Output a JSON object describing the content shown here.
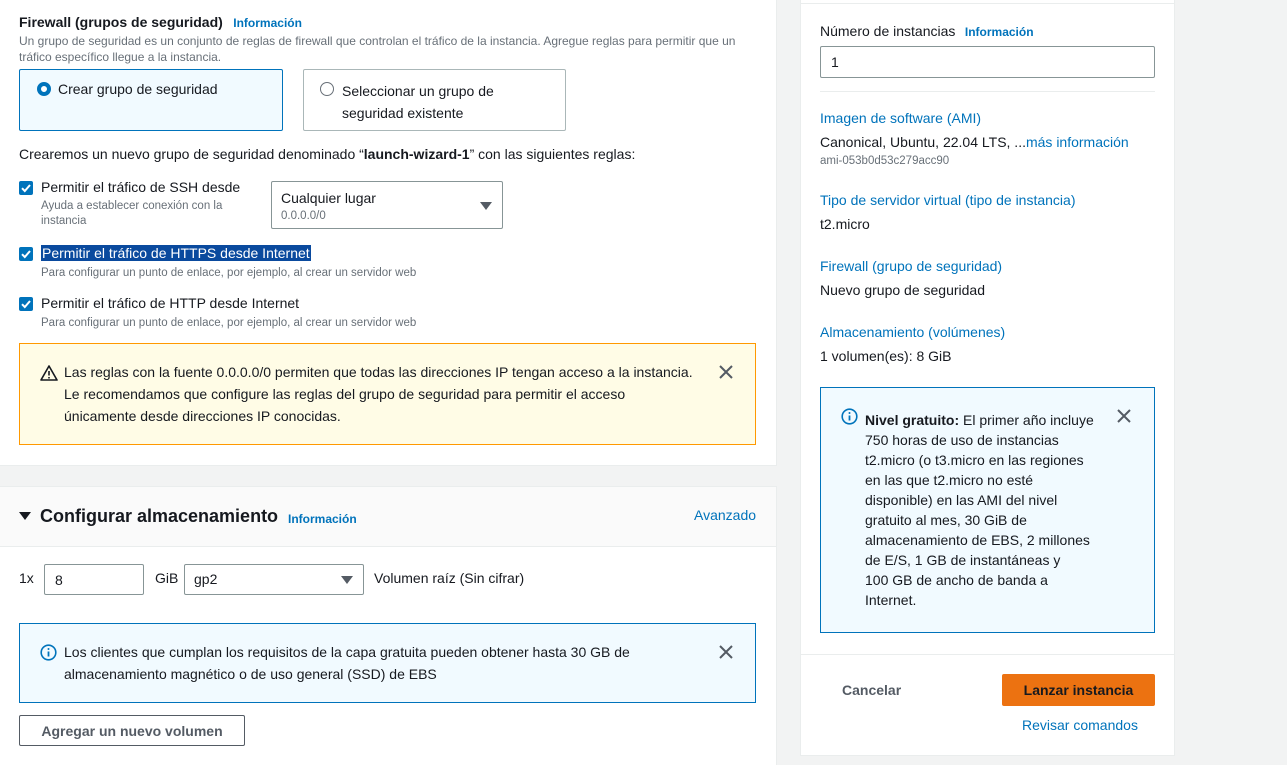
{
  "firewall": {
    "title": "Firewall (grupos de seguridad)",
    "info": "Información",
    "description_line1": "Un grupo de seguridad es un conjunto de reglas de firewall que controlan el tráfico de la instancia. Agregue reglas para permitir que un",
    "description_line2": "tráfico específico llegue a la instancia.",
    "option_create": "Crear grupo de seguridad",
    "option_select_line1": "Seleccionar un grupo de",
    "option_select_line2": "seguridad existente",
    "statement_prefix": "Crearemos un nuevo grupo de seguridad denominado “",
    "group_name": "launch-wizard-1",
    "statement_suffix": "” con las siguientes reglas:",
    "ssh_label": "Permitir el tráfico de SSH desde",
    "ssh_help_line1": "Ayuda a establecer conexión con la",
    "ssh_help_line2": "instancia",
    "ssh_source_value": "Cualquier lugar",
    "ssh_source_sub": "0.0.0.0/0",
    "https_label": "Permitir el tráfico de HTTPS desde Internet",
    "https_help": "Para configurar un punto de enlace, por ejemplo, al crear un servidor web",
    "http_label": "Permitir el tráfico de HTTP desde Internet",
    "http_help": "Para configurar un punto de enlace, por ejemplo, al crear un servidor web",
    "warning_line1": "Las reglas con la fuente 0.0.0.0/0 permiten que todas las direcciones IP tengan acceso a la instancia.",
    "warning_line2": "Le recomendamos que configure las reglas del grupo de seguridad para permitir el acceso",
    "warning_line3": "únicamente desde direcciones IP conocidas."
  },
  "storage": {
    "title": "Configurar almacenamiento",
    "info": "Información",
    "advanced": "Avanzado",
    "count_prefix": "1x",
    "size_value": "8",
    "unit": "GiB",
    "volume_type": "gp2",
    "volume_desc": "Volumen raíz  (Sin cifrar)",
    "info_line1": "Los clientes que cumplan los requisitos de la capa gratuita pueden obtener hasta 30 GB de",
    "info_line2": "almacenamiento magnético o de uso general (SSD) de EBS",
    "add_volume": "Agregar un nuevo volumen"
  },
  "summary": {
    "instances_label": "Número de instancias",
    "instances_info": "Información",
    "instances_value": "1",
    "ami_label": "Imagen de software (AMI)",
    "ami_value": "Canonical, Ubuntu, 22.04 LTS, ...",
    "ami_more": "más información",
    "ami_id": "ami-053b0d53c279acc90",
    "type_label": "Tipo de servidor virtual (tipo de instancia)",
    "type_value": "t2.micro",
    "firewall_label": "Firewall (grupo de seguridad)",
    "firewall_value": "Nuevo grupo de seguridad",
    "storage_label": "Almacenamiento (volúmenes)",
    "storage_value": "1 volumen(es): 8 GiB",
    "free_tier_bold": "Nivel gratuito:",
    "free_tier_lines": [
      " El primer año incluye",
      "750 horas de uso de instancias",
      "t2.micro (o t3.micro en las regiones",
      "en las que t2.micro no esté",
      "disponible) en las AMI del nivel",
      "gratuito al mes, 30 GiB de",
      "almacenamiento de EBS, 2 millones",
      "de E/S, 1 GB de instantáneas y",
      "100 GB de ancho de banda a",
      "Internet."
    ],
    "cancel": "Cancelar",
    "launch": "Lanzar instancia",
    "review": "Revisar comandos"
  }
}
